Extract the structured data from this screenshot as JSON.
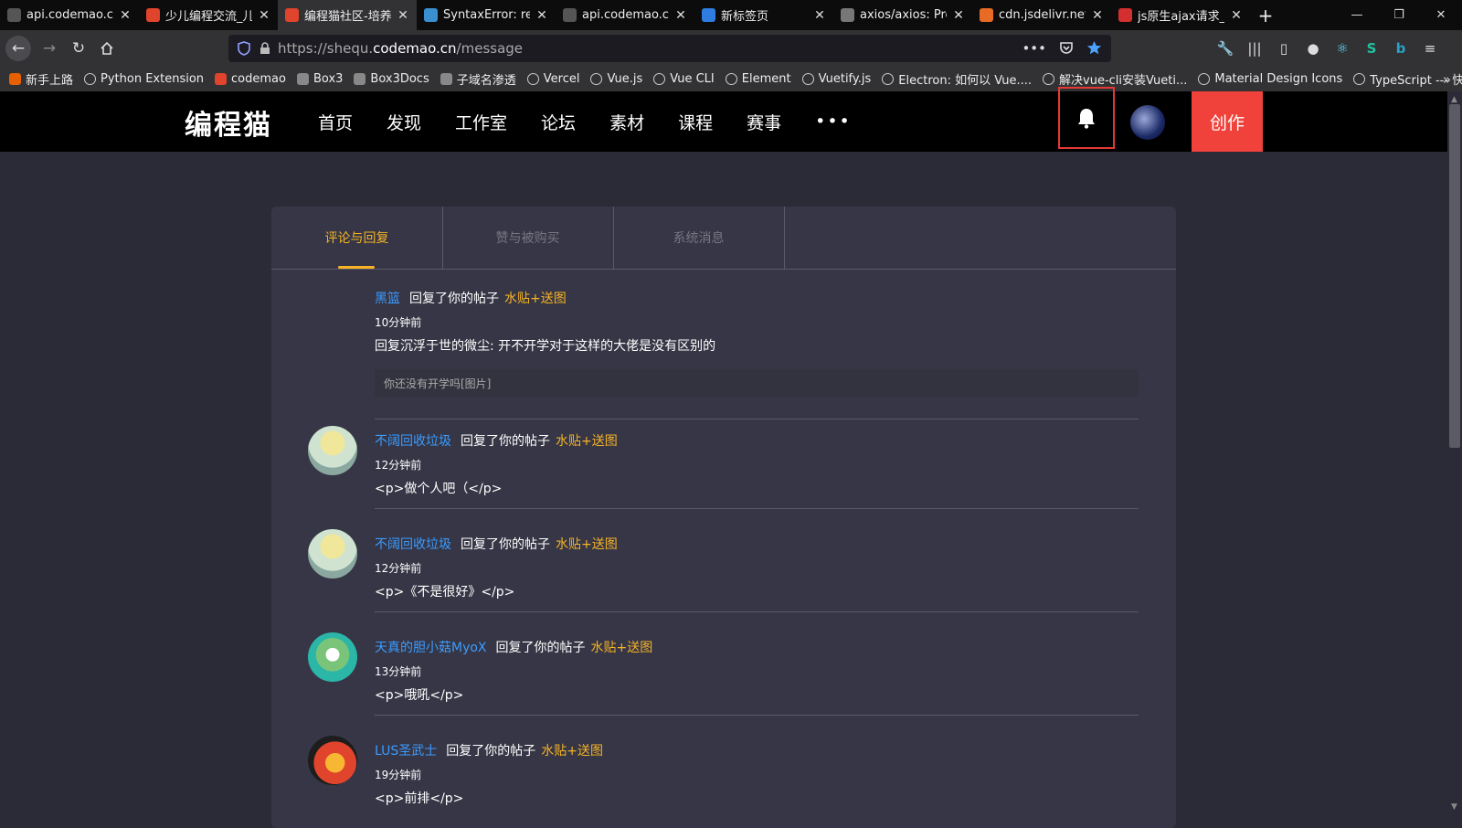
{
  "browser": {
    "tabs": [
      {
        "title": "api.codemao.cn/wel",
        "favicon_color": "#555555"
      },
      {
        "title": "少儿编程交流_儿",
        "favicon_color": "#e0442c"
      },
      {
        "title": "编程猫社区-培养",
        "favicon_color": "#e0442c",
        "active": true
      },
      {
        "title": "SyntaxError: red",
        "favicon_color": "#3a8fd1"
      },
      {
        "title": "api.codemao.cn/wel",
        "favicon_color": "#555555"
      },
      {
        "title": "新标签页",
        "favicon_color": "#2f7de1"
      },
      {
        "title": "axios/axios: Pro",
        "favicon_color": "#777777"
      },
      {
        "title": "cdn.jsdelivr.net/",
        "favicon_color": "#e86b25"
      },
      {
        "title": "js原生ajax请求_",
        "favicon_color": "#d32f2f"
      }
    ],
    "close_glyph": "✕",
    "new_tab_glyph": "+",
    "url": {
      "prefix": "https://shequ.",
      "host": "codemao.cn",
      "path": "/message"
    },
    "bookmarks": [
      {
        "label": "新手上路",
        "icon": "firefox-icon"
      },
      {
        "label": "Python Extension",
        "icon": "globe-icon"
      },
      {
        "label": "codemao",
        "icon": "codemao-icon"
      },
      {
        "label": "Box3",
        "icon": "box3-icon"
      },
      {
        "label": "Box3Docs",
        "icon": "box3docs-icon"
      },
      {
        "label": "子域名渗透",
        "icon": "doc-icon"
      },
      {
        "label": "Vercel",
        "icon": "globe-icon"
      },
      {
        "label": "Vue.js",
        "icon": "globe-icon"
      },
      {
        "label": "Vue CLI",
        "icon": "globe-icon"
      },
      {
        "label": "Element",
        "icon": "globe-icon"
      },
      {
        "label": "Vuetify.js",
        "icon": "globe-icon"
      },
      {
        "label": "Electron: 如何以 Vue....",
        "icon": "globe-icon"
      },
      {
        "label": "解决vue-cli安装Vueti...",
        "icon": "globe-icon"
      },
      {
        "label": "Material Design Icons",
        "icon": "globe-icon"
      },
      {
        "label": "TypeScript --- 快速...",
        "icon": "globe-icon"
      }
    ]
  },
  "site": {
    "logo": "编程猫",
    "nav": [
      "首页",
      "发现",
      "工作室",
      "论坛",
      "素材",
      "课程",
      "赛事"
    ],
    "nav_more": "•••",
    "create_label": "创作",
    "accent": "#f5b324",
    "link_color": "#3b9cff",
    "create_color": "#f0413a"
  },
  "message_tabs": [
    {
      "label": "评论与回复",
      "active": true
    },
    {
      "label": "赞与被购买"
    },
    {
      "label": "系统消息"
    }
  ],
  "messages": [
    {
      "user": "黑篮",
      "verb": "回复了你的帖子",
      "post": "水贴+送图",
      "time": "10分钟前",
      "content": "回复沉浮于世的微尘: 开不开学对于这样的大佬是没有区别的",
      "quote": "你还没有开学吗[图片]",
      "avatar": "none"
    },
    {
      "user": "不阔回收垃圾",
      "verb": "回复了你的帖子",
      "post": "水贴+送图",
      "time": "12分钟前",
      "content": "<p>做个人吧（</p>",
      "avatar": "blonde-character"
    },
    {
      "user": "不阔回收垃圾",
      "verb": "回复了你的帖子",
      "post": "水贴+送图",
      "time": "12分钟前",
      "content": "<p>《不是很好》</p>",
      "avatar": "blonde-character"
    },
    {
      "user": "天真的胆小菇MyoX",
      "verb": "回复了你的帖子",
      "post": "水贴+送图",
      "time": "13分钟前",
      "content": "<p>哦吼</p>",
      "avatar": "green-mascot"
    },
    {
      "user": "LUS圣武士",
      "verb": "回复了你的帖子",
      "post": "水贴+送图",
      "time": "19分钟前",
      "content": "<p>前排</p>",
      "avatar": "red-robot"
    }
  ]
}
